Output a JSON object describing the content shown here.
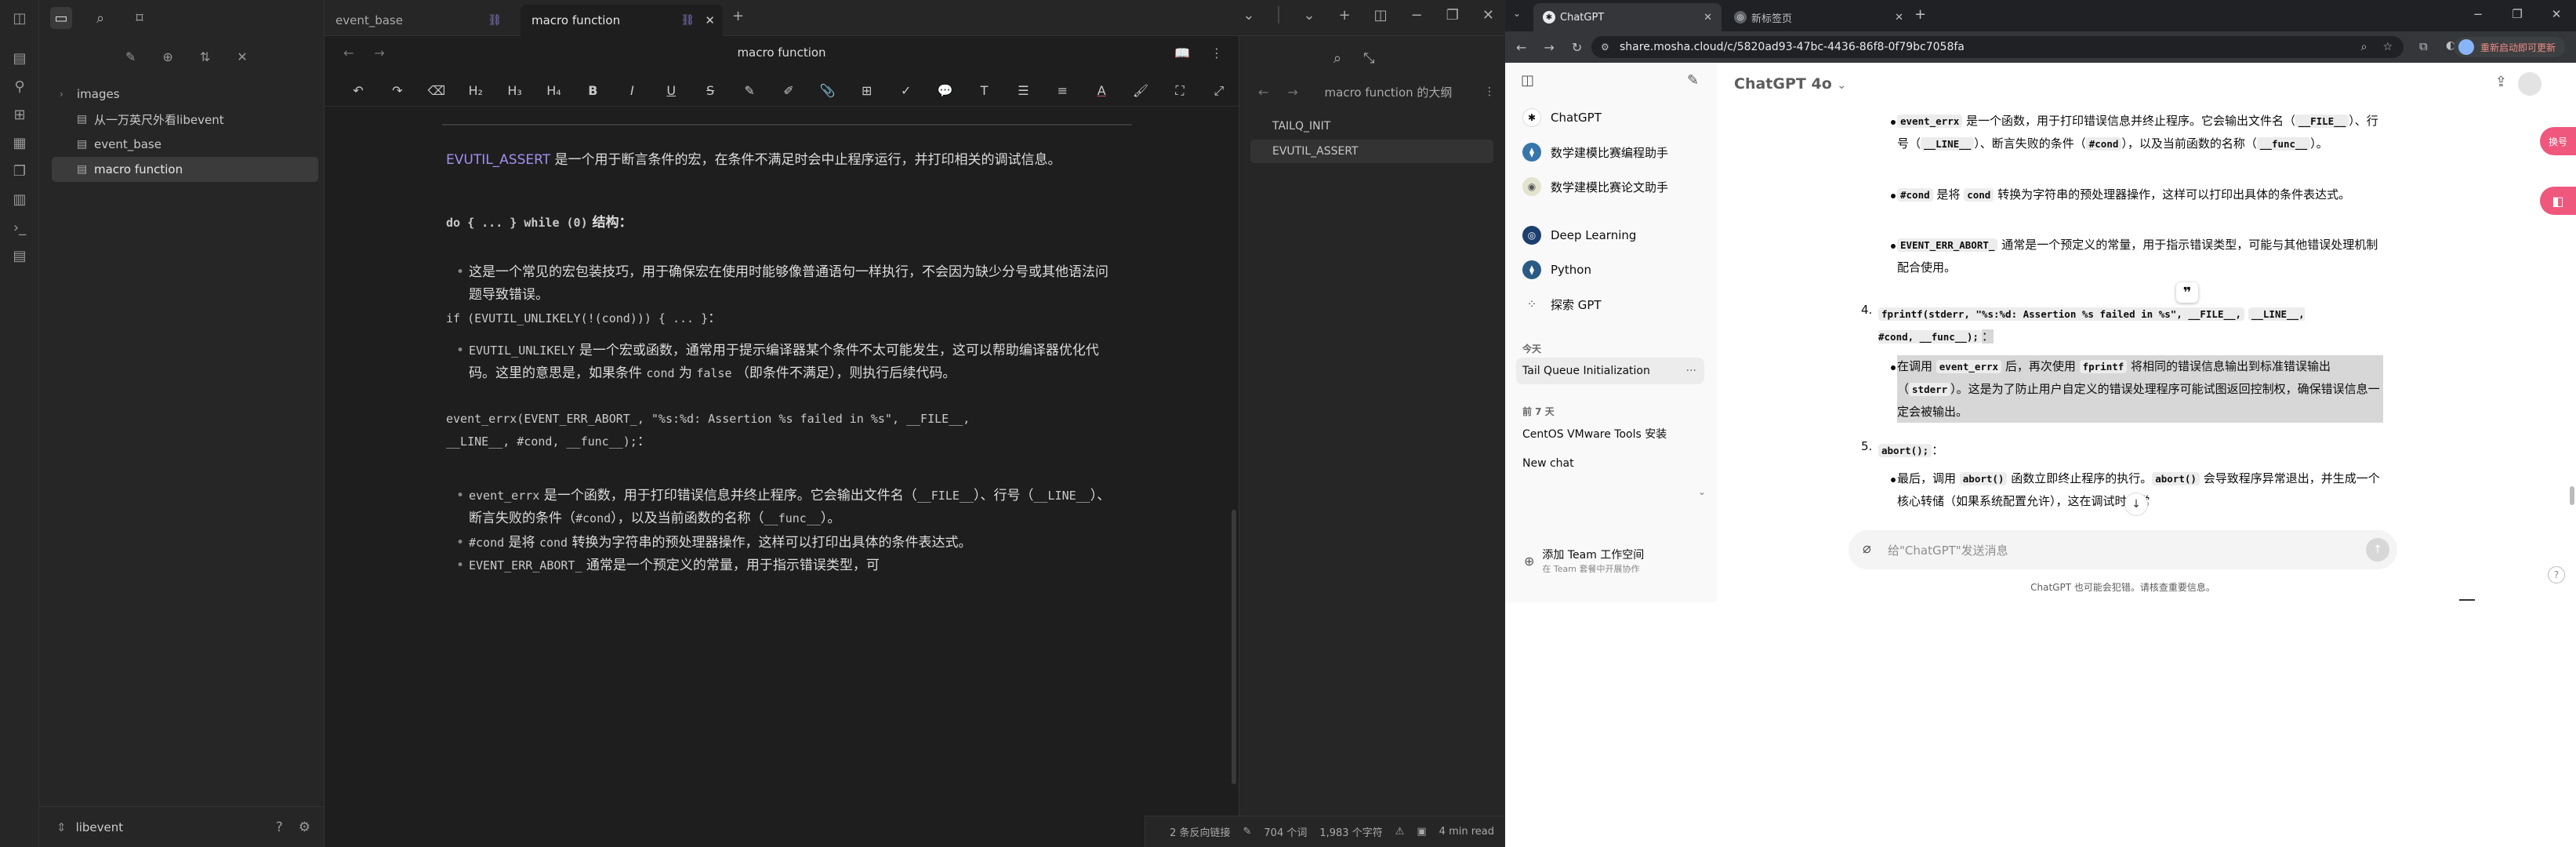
{
  "obsidian": {
    "tabs": [
      {
        "label": "event_base"
      },
      {
        "label": "macro function"
      }
    ],
    "view_title": "macro function",
    "file_tree": {
      "folder": "images",
      "files": [
        "从一万英尺外看libevent",
        "event_base",
        "macro function"
      ],
      "active": "macro function"
    },
    "vault_name": "libevent",
    "format_toolbar": [
      "↶",
      "↷",
      "⌫",
      "H₂",
      "H₃",
      "H₄",
      "B",
      "I",
      "U",
      "S",
      "✎",
      "✐",
      "📎",
      "⊞",
      "✓",
      "💬",
      "T",
      "☰",
      "≡",
      "A",
      "🖌",
      "⛶",
      "⤢"
    ],
    "content": {
      "p1_accent": "EVUTIL_ASSERT",
      "p1_text": " 是一个用于断言条件的宏，在条件不满足时会中止程序运行，并打印相关的调试信息。",
      "h_do_code": "do { ... } while (0)",
      "h_do_text": " 结构",
      "b1": "这是一个常见的宏包装技巧，用于确保宏在使用时能够像普通语句一样执行，不会因为缺少分号或其他语法问题导致错误。",
      "code_if": "if (EVUTIL_UNLIKELY(!(cond))) { ... }",
      "code_colon": "：",
      "b2_code1": "EVUTIL_UNLIKELY",
      "b2_text1": " 是一个宏或函数，通常用于提示编译器某个条件不太可能发生，这可以帮助编译器优化代码。这里的意思是，如果条件 ",
      "b2_code2": "cond",
      "b2_text2": " 为 ",
      "b2_code3": "false",
      "b2_text3": " （即条件不满足），则执行后续代码。",
      "code_errx_1": "event_errx(EVENT_ERR_ABORT_, \"%s:%d: Assertion %s failed in %s\", __FILE__,",
      "code_errx_2": "__LINE__, #cond, __func__);",
      "b3_code": "event_errx",
      "b3_text": " 是一个函数，用于打印错误信息并终止程序。它会输出文件名（",
      "b3_file": "__FILE__",
      "b3_mid1": "）、行号（",
      "b3_line": "__LINE__",
      "b3_mid2": "）、断言失败的条件（",
      "b3_cond": "#cond",
      "b3_mid3": "），以及当前函数的名称（",
      "b3_func": "__func__",
      "b3_end": "）。",
      "b4_code": "#cond",
      "b4_text1": " 是将 ",
      "b4_code2": "cond",
      "b4_text2": " 转换为字符串的预处理器操作，这样可以打印出具体的条件表达式。",
      "b5_code": "EVENT_ERR_ABORT_",
      "b5_text": " 通常是一个预定义的常量，用于指示错误类型，可"
    },
    "outline": {
      "title": "macro function 的大纲",
      "items": [
        "TAILQ_INIT",
        "EVUTIL_ASSERT"
      ],
      "active": "EVUTIL_ASSERT"
    },
    "status": {
      "backlinks": "2 条反向链接",
      "words": "704 个词",
      "chars": "1,983 个字符",
      "read": "4 min read"
    }
  },
  "browser": {
    "tabs": [
      {
        "label": "ChatGPT"
      },
      {
        "label": "新标签页"
      }
    ],
    "url": "share.mosha.cloud/c/5820ad93-47bc-4436-86f8-0f79bc7058fa",
    "restart_label": "重新启动即可更新"
  },
  "chatgpt": {
    "model": "ChatGPT 4o",
    "sidebar": {
      "items": [
        "ChatGPT",
        "数学建模比赛编程助手",
        "数学建模比赛论文助手",
        "Deep Learning",
        "Python",
        "探索 GPT"
      ],
      "today_label": "今天",
      "today": [
        "Tail Queue Initialization"
      ],
      "week_label": "前 7 天",
      "week": [
        "CentOS VMware Tools 安装",
        "New chat"
      ],
      "team_title": "添加 Team 工作空间",
      "team_sub": "在 Team 套餐中开展协作"
    },
    "messages": {
      "b1_code1": "event_errx",
      "b1_t1": " 是一个函数，用于打印错误信息并终止程序。它会输出文件名（",
      "b1_file": "__FILE__",
      "b1_t2": "）、行号（",
      "b1_line": "__LINE__",
      "b1_t3": "）、断言失败的条件（",
      "b1_cond": "#cond",
      "b1_t4": "），以及当前函数的名称（",
      "b1_func": "__func__",
      "b1_t5": "）。",
      "b2_code1": "#cond",
      "b2_t1": " 是将 ",
      "b2_code2": "cond",
      "b2_t2": " 转换为字符串的预处理器操作，这样可以打印出具体的条件表达式。",
      "b3_code": "EVENT_ERR_ABORT_",
      "b3_t1": " 通常是一个预定义的常量，用于指示错误类型，可能",
      "b3_t2": "与其他错误处理机制配合使用。",
      "n4": "4.",
      "n4_code_a": "fprintf(stderr, \"%s:%d: Assertion %s failed in %s\", __FILE__,",
      "n4_code_b": "__LINE__, #cond, __func__);",
      "n4_colon": "：",
      "n4_b_t1": "在调用 ",
      "n4_b_code1": "event_errx",
      "n4_b_t2": " 后，再次使用 ",
      "n4_b_code2": "fprintf",
      "n4_b_t3": " 将相同的错误信息输出到标准错误输出（",
      "n4_b_code3": "stderr",
      "n4_b_t4": "）。这是为了防止用户自定义的错误处理程序可能试图返回控制权，确保错误信息一定会被输出。",
      "n5": "5.",
      "n5_code": "abort();",
      "n5_colon": "：",
      "n5_b_t1": "最后，调用 ",
      "n5_b_code1": "abort()",
      "n5_b_t2": " 函数立即终止程序的执行。",
      "n5_b_code2": "abort()",
      "n5_b_t3": " 会导致程序异常退出，并生成一个核心转储（如果系统配置允许），这在调试时非常"
    },
    "composer_placeholder": "给\"ChatGPT\"发送消息",
    "disclaimer": "ChatGPT 也可能会犯错。请核查重要信息。",
    "float_translate": "换号",
    "quote_icon": "❞"
  },
  "colors": {
    "obsidian_bg": "#1e1e1e",
    "obsidian_accent": "#a48ff0",
    "chrome_dark": "#202124",
    "float_pink": "#f0577d"
  }
}
